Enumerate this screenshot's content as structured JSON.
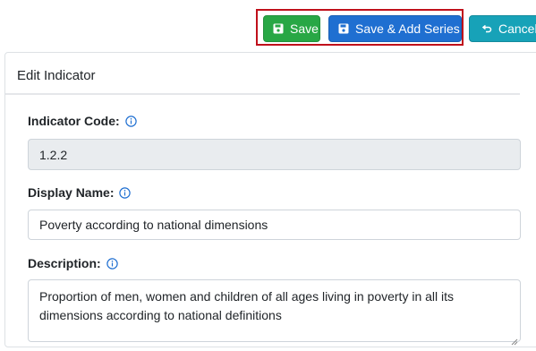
{
  "toolbar": {
    "save_label": "Save",
    "save_add_label": "Save & Add Series",
    "cancel_label": "Cancel"
  },
  "card": {
    "title": "Edit Indicator"
  },
  "form": {
    "indicator_code": {
      "label": "Indicator Code:",
      "value": "1.2.2"
    },
    "display_name": {
      "label": "Display Name:",
      "value": "Poverty according to national dimensions"
    },
    "description": {
      "label": "Description:",
      "value": "Proportion of men, women and children of all ages living in poverty in all its dimensions according to national definitions"
    }
  },
  "colors": {
    "save": "#28a745",
    "save_add": "#1f6fd1",
    "cancel": "#17a2b8",
    "highlight": "#c0101b",
    "info_icon": "#1f6fd1"
  },
  "icons": {
    "save": "floppy-disk-icon",
    "cancel": "undo-arrow-icon",
    "info": "info-circle-icon"
  }
}
